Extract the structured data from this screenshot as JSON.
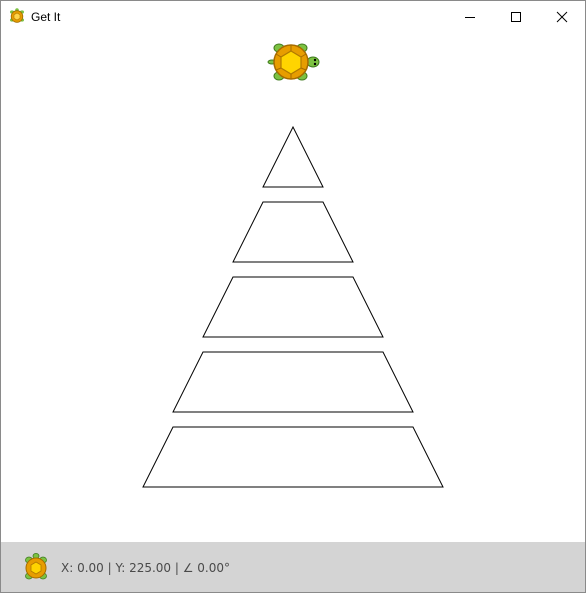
{
  "window": {
    "title": "Get It",
    "controls": [
      "minimize",
      "maximize",
      "close"
    ]
  },
  "canvas": {
    "turtle_icon": "turtle-icon",
    "shapes": [
      "triangle",
      "trapezoid",
      "trapezoid",
      "trapezoid",
      "trapezoid"
    ]
  },
  "status": {
    "text": "X: 0.00 | Y: 225.00 | ∠ 0.00°",
    "x": 0.0,
    "y": 225.0,
    "heading_deg": 0.0
  },
  "colors": {
    "turtle_shell": "#f2b705",
    "turtle_shell_inner": "#ffd54a",
    "turtle_body": "#7cc242",
    "status_bg": "#d4d4d4"
  }
}
